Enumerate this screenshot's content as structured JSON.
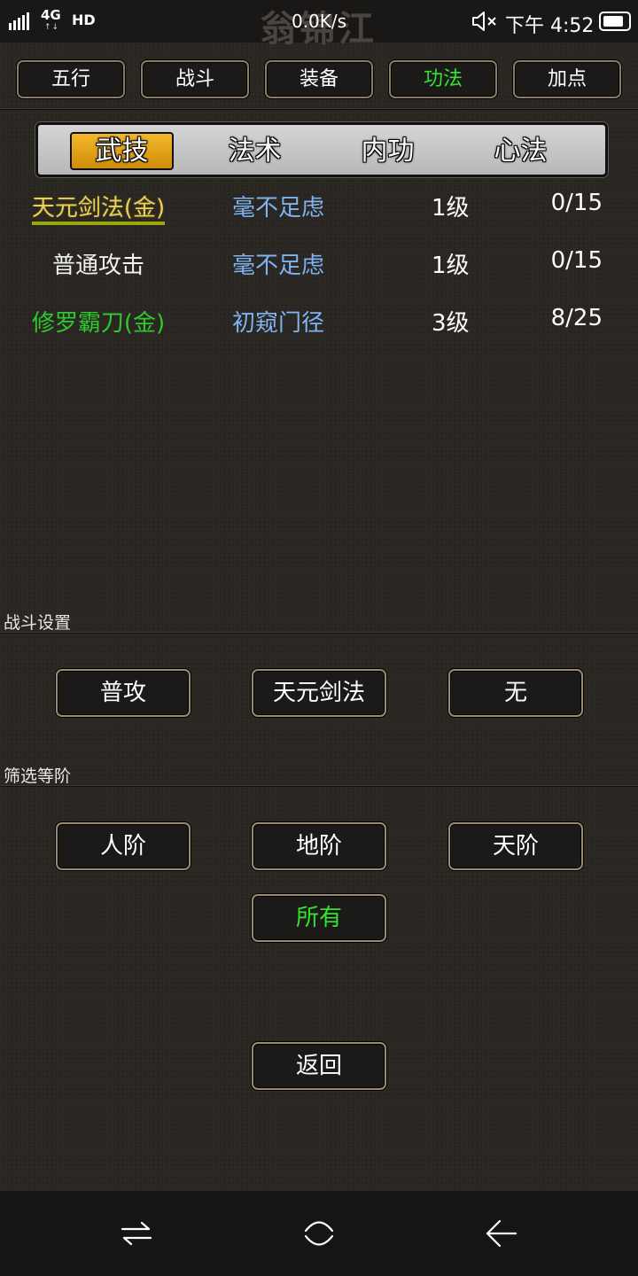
{
  "status_bar": {
    "network": "4G",
    "network_arrows": "↑↓",
    "hd": "HD",
    "ghost_title": "翁锦江",
    "speed": "0.0K/s",
    "time": "下午 4:52",
    "battery_level": 0.85
  },
  "top_tabs": [
    {
      "label": "五行",
      "active": false
    },
    {
      "label": "战斗",
      "active": false
    },
    {
      "label": "装备",
      "active": false
    },
    {
      "label": "功法",
      "active": true
    },
    {
      "label": "加点",
      "active": false
    }
  ],
  "sub_tabs": [
    {
      "label": "武技",
      "active": true
    },
    {
      "label": "法术",
      "active": false
    },
    {
      "label": "内功",
      "active": false
    },
    {
      "label": "心法",
      "active": false
    }
  ],
  "skills": [
    {
      "name": "天元剑法(金)",
      "state": "毫不足虑",
      "level": "1级",
      "progress": "0/15",
      "color": "#e9d05a"
    },
    {
      "name": "普通攻击",
      "state": "毫不足虑",
      "level": "1级",
      "progress": "0/15",
      "color": "#f2f2f2"
    },
    {
      "name": "修罗霸刀(金)",
      "state": "初窥门径",
      "level": "3级",
      "progress": "8/25",
      "color": "#2ec92e"
    }
  ],
  "battle_settings": {
    "title": "战斗设置",
    "buttons": [
      "普攻",
      "天元剑法",
      "无"
    ]
  },
  "filter": {
    "title": "筛选等阶",
    "buttons": [
      {
        "label": "人阶",
        "active": false
      },
      {
        "label": "地阶",
        "active": false
      },
      {
        "label": "天阶",
        "active": false
      },
      {
        "label": "所有",
        "active": true
      }
    ]
  },
  "back_button": "返回",
  "colors": {
    "active_green": "#33e233",
    "gold_tab": "#e0a21a",
    "state_blue": "#7fb3f2"
  },
  "nav_icons": [
    "recent-apps-icon",
    "home-icon",
    "back-icon"
  ]
}
